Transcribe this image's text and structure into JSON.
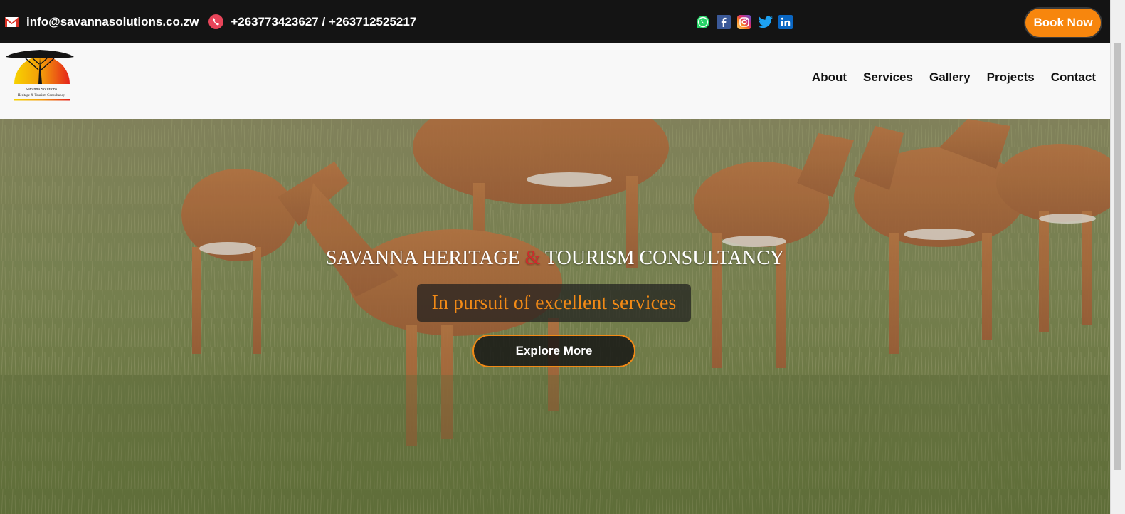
{
  "topbar": {
    "email": "info@savannasolutions.co.zw",
    "phones": "+263773423627 / +263712525217",
    "book_label": "Book Now",
    "socials": [
      "whatsapp-icon",
      "facebook-icon",
      "instagram-icon",
      "twitter-icon",
      "linkedin-icon"
    ]
  },
  "logo": {
    "line1": "Savanna Solutions",
    "line2": "Heritage & Tourism Consultancy"
  },
  "nav": {
    "items": [
      "About",
      "Services",
      "Gallery",
      "Projects",
      "Contact"
    ]
  },
  "hero": {
    "title_part1": "SAVANNA HERITAGE ",
    "title_amp": "&",
    "title_part2": " TOURISM CONSULTANCY",
    "tagline": "In pursuit of excellent services",
    "cta_label": "Explore More"
  },
  "colors": {
    "topbar_bg": "#141414",
    "accent_orange": "#f7860d",
    "amp_red": "#d3282c"
  }
}
